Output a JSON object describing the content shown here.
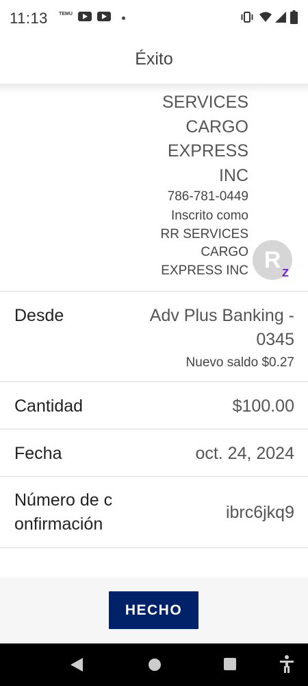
{
  "status_bar": {
    "time": "11:13",
    "temu_label": "TEMU",
    "icons": [
      "temu-icon",
      "youtube-icon",
      "youtube-icon",
      "dot-icon",
      "vibrate-icon",
      "wifi-icon",
      "signal-icon",
      "battery-icon"
    ]
  },
  "header": {
    "title": "Éxito"
  },
  "recipient": {
    "name_lines": [
      "SERVICES",
      "CARGO",
      "EXPRESS",
      "INC"
    ],
    "phone": "786-781-0449",
    "enrolled_lines": [
      "Inscrito como",
      "RR SERVICES",
      "CARGO",
      "EXPRESS INC"
    ],
    "avatar_letter": "R",
    "zelle_mark": "Z"
  },
  "details": {
    "from": {
      "label": "Desde",
      "value_lines": [
        "Adv Plus Banking -",
        "0345"
      ],
      "sub": "Nuevo saldo $0.27"
    },
    "amount": {
      "label": "Cantidad",
      "value": "$100.00"
    },
    "date": {
      "label": "Fecha",
      "value": "oct. 24, 2024"
    },
    "confirmation": {
      "label_lines": [
        "Número de c",
        "onfirmación"
      ],
      "value": "ibrc6jkq9"
    }
  },
  "done_button": {
    "label": "HECHO",
    "color": "#012169"
  },
  "colors": {
    "zelle_purple": "#6d1ed4",
    "avatar_gray": "#d6d6d6"
  }
}
